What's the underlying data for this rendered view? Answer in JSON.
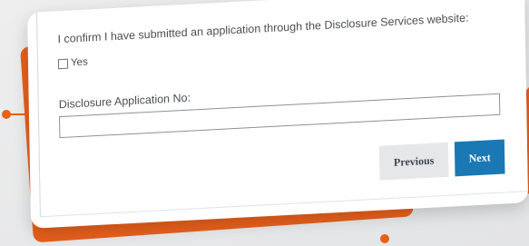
{
  "form": {
    "confirm_text": "I confirm I have submitted an application through the Disclosure Services website:",
    "checkbox_label": "Yes",
    "checkbox_checked": false,
    "field_label": "Disclosure Application No:",
    "field_value": "",
    "previous_label": "Previous",
    "next_label": "Next"
  },
  "colors": {
    "accent_orange": "#e8601c",
    "next_button": "#1a78b4",
    "previous_button": "#e6e7e9"
  }
}
